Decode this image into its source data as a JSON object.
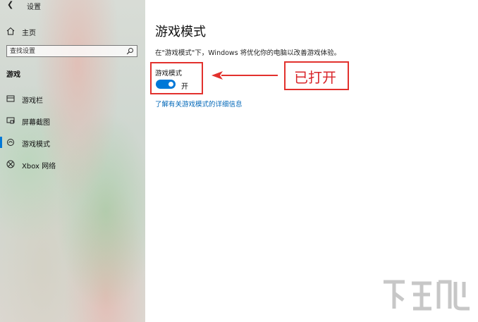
{
  "window": {
    "title": "设置"
  },
  "sidebar": {
    "home_label": "主页",
    "search_placeholder": "查找设置",
    "section_title": "游戏",
    "items": [
      {
        "label": "游戏栏",
        "icon": "gamebar-icon"
      },
      {
        "label": "屏幕截图",
        "icon": "capture-icon"
      },
      {
        "label": "游戏模式",
        "icon": "gamemode-icon",
        "selected": true
      },
      {
        "label": "Xbox 网络",
        "icon": "xbox-icon"
      }
    ]
  },
  "main": {
    "title": "游戏模式",
    "description": "在\"游戏模式\"下，Windows 将优化你的电脑以改善游戏体验。",
    "toggle_label": "游戏模式",
    "toggle_state": "开",
    "toggle_on": true,
    "link_text": "了解有关游戏模式的详细信息"
  },
  "annotation": {
    "text": "已打开",
    "color": "#e2312d"
  },
  "colors": {
    "accent": "#0078d7",
    "link": "#0067b8",
    "annotation": "#e2312d"
  }
}
